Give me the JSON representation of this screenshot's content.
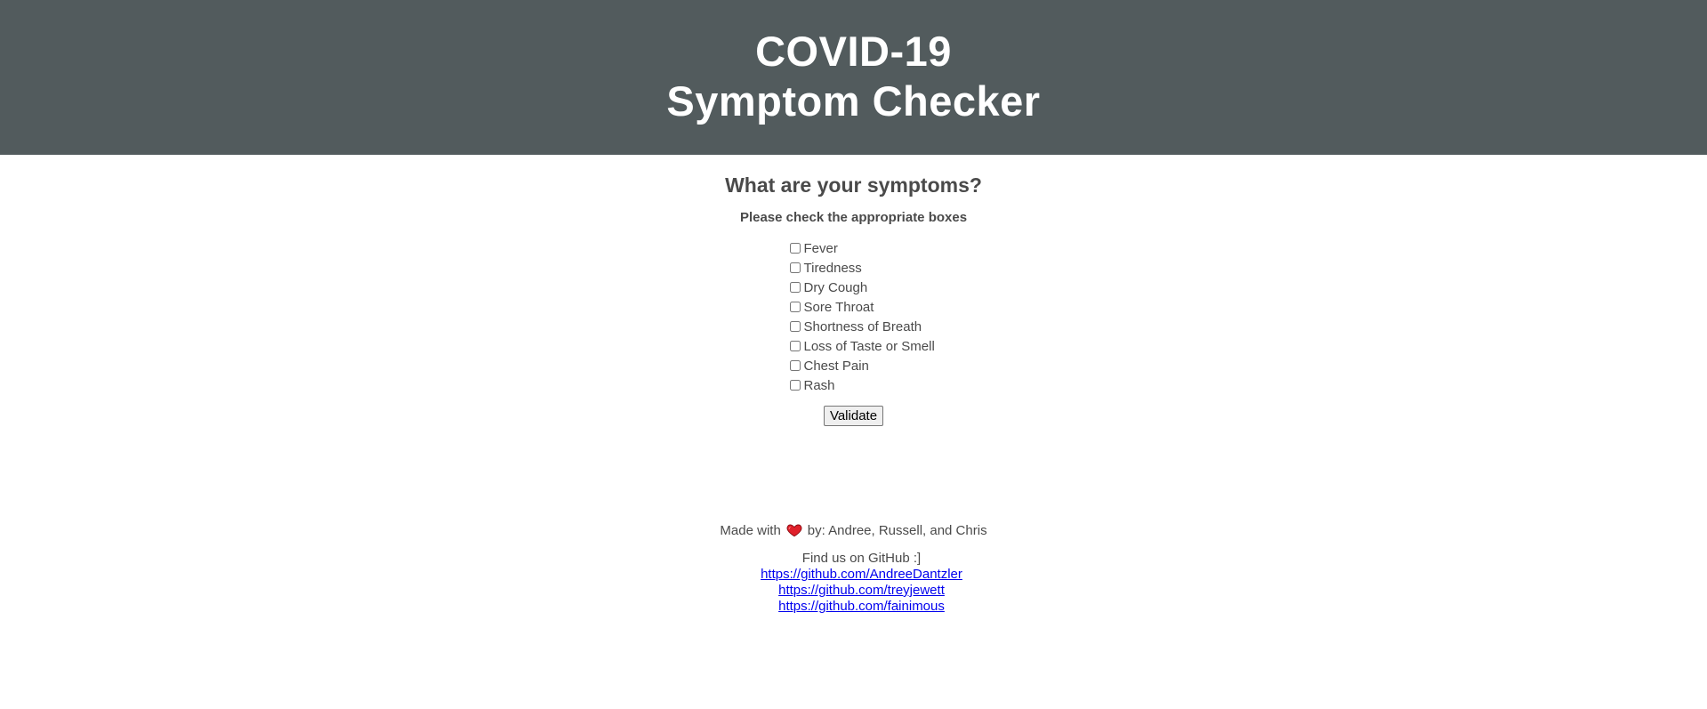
{
  "header": {
    "title_line1": "COVID-19",
    "title_line2": "Symptom Checker",
    "background_color": "#525b5d"
  },
  "form": {
    "question": "What are your symptoms?",
    "instruction": "Please check the appropriate boxes",
    "symptoms": [
      {
        "label": "Fever",
        "checked": false
      },
      {
        "label": "Tiredness",
        "checked": false
      },
      {
        "label": "Dry Cough",
        "checked": false
      },
      {
        "label": "Sore Throat",
        "checked": false
      },
      {
        "label": "Shortness of Breath",
        "checked": false
      },
      {
        "label": "Loss of Taste or Smell",
        "checked": false
      },
      {
        "label": "Chest Pain",
        "checked": false
      },
      {
        "label": "Rash",
        "checked": false
      }
    ],
    "validate_label": "Validate"
  },
  "footer": {
    "made_with_prefix": "Made with",
    "heart_icon": "heart-icon",
    "made_with_suffix": "by: Andree, Russell, and Chris",
    "find_us": "Find us on GitHub :]",
    "links": [
      "https://github.com/AndreeDantzler",
      "https://github.com/treyjewett",
      "https://github.com/fainimous"
    ],
    "link_color": "#0000ee",
    "heart_color": "#e0202a"
  }
}
